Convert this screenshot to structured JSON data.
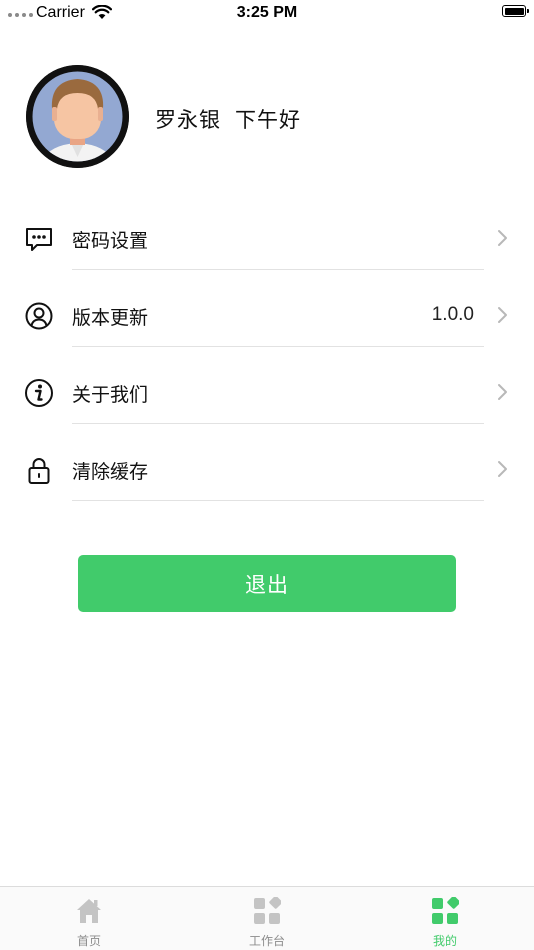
{
  "status_bar": {
    "carrier": "Carrier",
    "time": "3:25 PM",
    "battery_level": 1.0
  },
  "profile": {
    "name": "罗永银",
    "greeting": "下午好"
  },
  "menu": {
    "items": [
      {
        "label": "密码设置",
        "value": "",
        "icon": "message-dots-icon"
      },
      {
        "label": "版本更新",
        "value": "1.0.0",
        "icon": "user-circle-icon"
      },
      {
        "label": "关于我们",
        "value": "",
        "icon": "info-circle-icon"
      },
      {
        "label": "清除缓存",
        "value": "",
        "icon": "lock-icon"
      }
    ]
  },
  "logout": {
    "label": "退出"
  },
  "tab_bar": {
    "tabs": [
      {
        "label": "首页",
        "icon": "home-icon",
        "active": false
      },
      {
        "label": "工作台",
        "icon": "workbench-grid-icon",
        "active": false
      },
      {
        "label": "我的",
        "icon": "my-grid-icon",
        "active": true
      }
    ]
  },
  "colors": {
    "accent": "#41cb6b",
    "inactive_tab": "#8c8c8c",
    "divider": "#e2e2e2"
  }
}
